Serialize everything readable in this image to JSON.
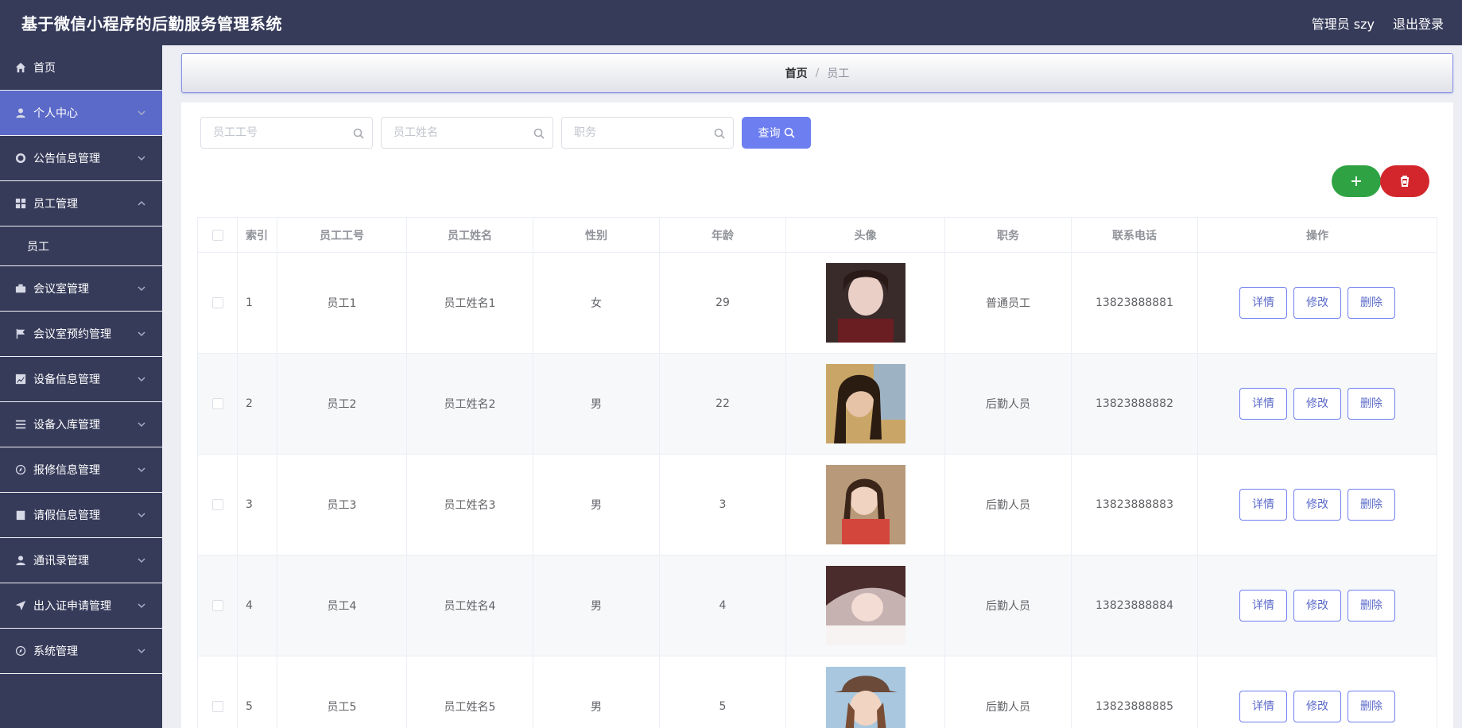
{
  "header": {
    "title": "基于微信小程序的后勤服务管理系统",
    "user": "管理员 szy",
    "logout": "退出登录"
  },
  "sidebar": {
    "items": [
      {
        "label": "首页",
        "icon": "home-icon"
      },
      {
        "label": "个人中心",
        "icon": "user-icon"
      },
      {
        "label": "公告信息管理",
        "icon": "lifebuoy-icon"
      },
      {
        "label": "员工管理",
        "icon": "grid-icon"
      },
      {
        "label": "员工"
      },
      {
        "label": "会议室管理",
        "icon": "briefcase-icon"
      },
      {
        "label": "会议室预约管理",
        "icon": "flag-icon"
      },
      {
        "label": "设备信息管理",
        "icon": "chart-icon"
      },
      {
        "label": "设备入库管理",
        "icon": "list-icon"
      },
      {
        "label": "报修信息管理",
        "icon": "compass-icon"
      },
      {
        "label": "请假信息管理",
        "icon": "clipboard-icon"
      },
      {
        "label": "通讯录管理",
        "icon": "person-icon"
      },
      {
        "label": "出入证申请管理",
        "icon": "send-icon"
      },
      {
        "label": "系统管理",
        "icon": "compass-icon"
      }
    ]
  },
  "breadcrumb": {
    "home": "首页",
    "sep": "/",
    "current": "员工"
  },
  "search": {
    "emp_no_placeholder": "员工工号",
    "emp_name_placeholder": "员工姓名",
    "position_placeholder": "职务",
    "query_label": "查询"
  },
  "table": {
    "headers": [
      "索引",
      "员工工号",
      "员工姓名",
      "性别",
      "年龄",
      "头像",
      "职务",
      "联系电话",
      "操作"
    ],
    "rows": [
      {
        "index": "1",
        "no": "员工1",
        "name": "员工姓名1",
        "gender": "女",
        "age": "29",
        "position": "普通员工",
        "phone": "13823888881"
      },
      {
        "index": "2",
        "no": "员工2",
        "name": "员工姓名2",
        "gender": "男",
        "age": "22",
        "position": "后勤人员",
        "phone": "13823888882"
      },
      {
        "index": "3",
        "no": "员工3",
        "name": "员工姓名3",
        "gender": "男",
        "age": "3",
        "position": "后勤人员",
        "phone": "13823888883"
      },
      {
        "index": "4",
        "no": "员工4",
        "name": "员工姓名4",
        "gender": "男",
        "age": "4",
        "position": "后勤人员",
        "phone": "13823888884"
      },
      {
        "index": "5",
        "no": "员工5",
        "name": "员工姓名5",
        "gender": "男",
        "age": "5",
        "position": "后勤人员",
        "phone": "13823888885"
      }
    ],
    "actions": {
      "detail": "详情",
      "edit": "修改",
      "delete": "删除"
    }
  },
  "colors": {
    "sidebar_bg": "#363b5a",
    "active_item": "#5b6ac9",
    "primary": "#6d7ef0",
    "add": "#2fa344",
    "remove": "#d2262c"
  }
}
